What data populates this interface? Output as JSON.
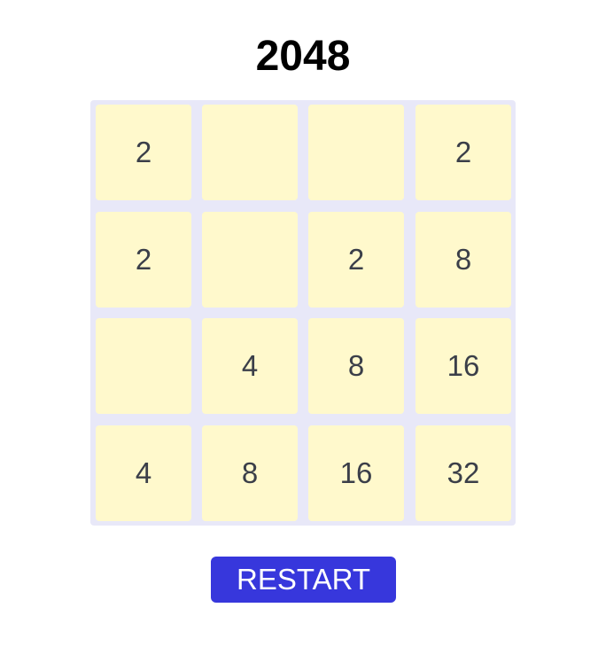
{
  "game": {
    "title": "2048",
    "restart_label": "RESTART"
  },
  "board": {
    "rows": [
      [
        "2",
        "",
        "",
        "2"
      ],
      [
        "2",
        "",
        "2",
        "8"
      ],
      [
        "",
        "4",
        "8",
        "16"
      ],
      [
        "4",
        "8",
        "16",
        "32"
      ]
    ]
  },
  "colors": {
    "board_background": "#e8e8f8",
    "tile_background": "#fff9cc",
    "tile_text": "#3b3f49",
    "button_background": "#3737dc",
    "button_text": "#ffffff"
  }
}
